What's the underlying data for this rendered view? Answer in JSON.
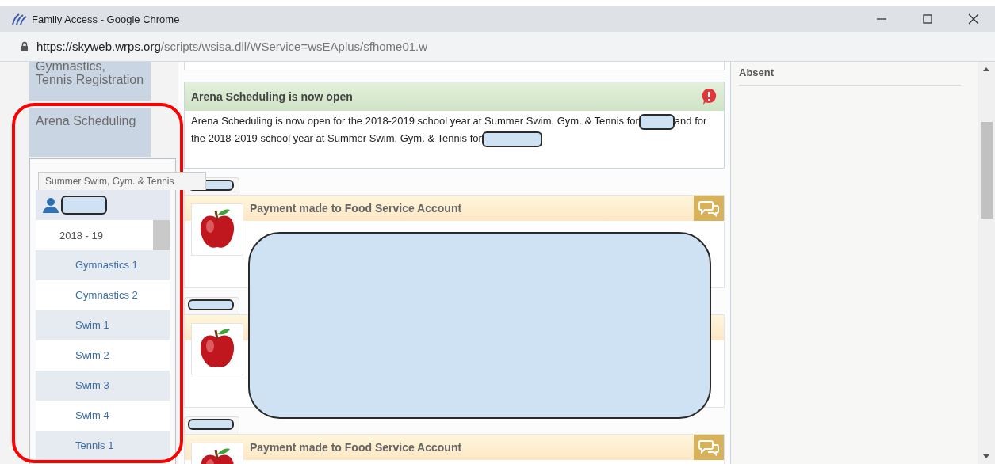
{
  "window": {
    "title": "Family Access - Google Chrome"
  },
  "address_bar": {
    "secure": true,
    "url_host": "https://skyweb.wrps.org",
    "url_path": "/scripts/wsisa.dll/WService=wsEAplus/sfhome01.w"
  },
  "sidebar": {
    "items": [
      {
        "label": "Gymnastics, Tennis Registration"
      },
      {
        "label": "Arena Scheduling"
      }
    ]
  },
  "arena_panel": {
    "tab": "Summer Swim, Gym. & Tennis",
    "year": "2018 - 19",
    "sessions": [
      "Gymnastics 1",
      "Gymnastics 2",
      "Swim 1",
      "Swim 2",
      "Swim 3",
      "Swim 4",
      "Tennis 1"
    ]
  },
  "messages": [
    {
      "kind": "alert",
      "title": "Arena Scheduling is now open",
      "body": [
        "Arena Scheduling is now open for the 2018-2019 school year at Summer Swim, Gym. & Tennis for",
        "and for the 2018-2019 school year at Summer Swim, Gym. & Tennis for"
      ]
    },
    {
      "kind": "payment",
      "title": "Payment made to Food Service Account"
    },
    {
      "kind": "payment"
    },
    {
      "kind": "payment",
      "title": "Payment made to Food Service Account"
    }
  ],
  "right_panel": {
    "heading": "Absent"
  }
}
